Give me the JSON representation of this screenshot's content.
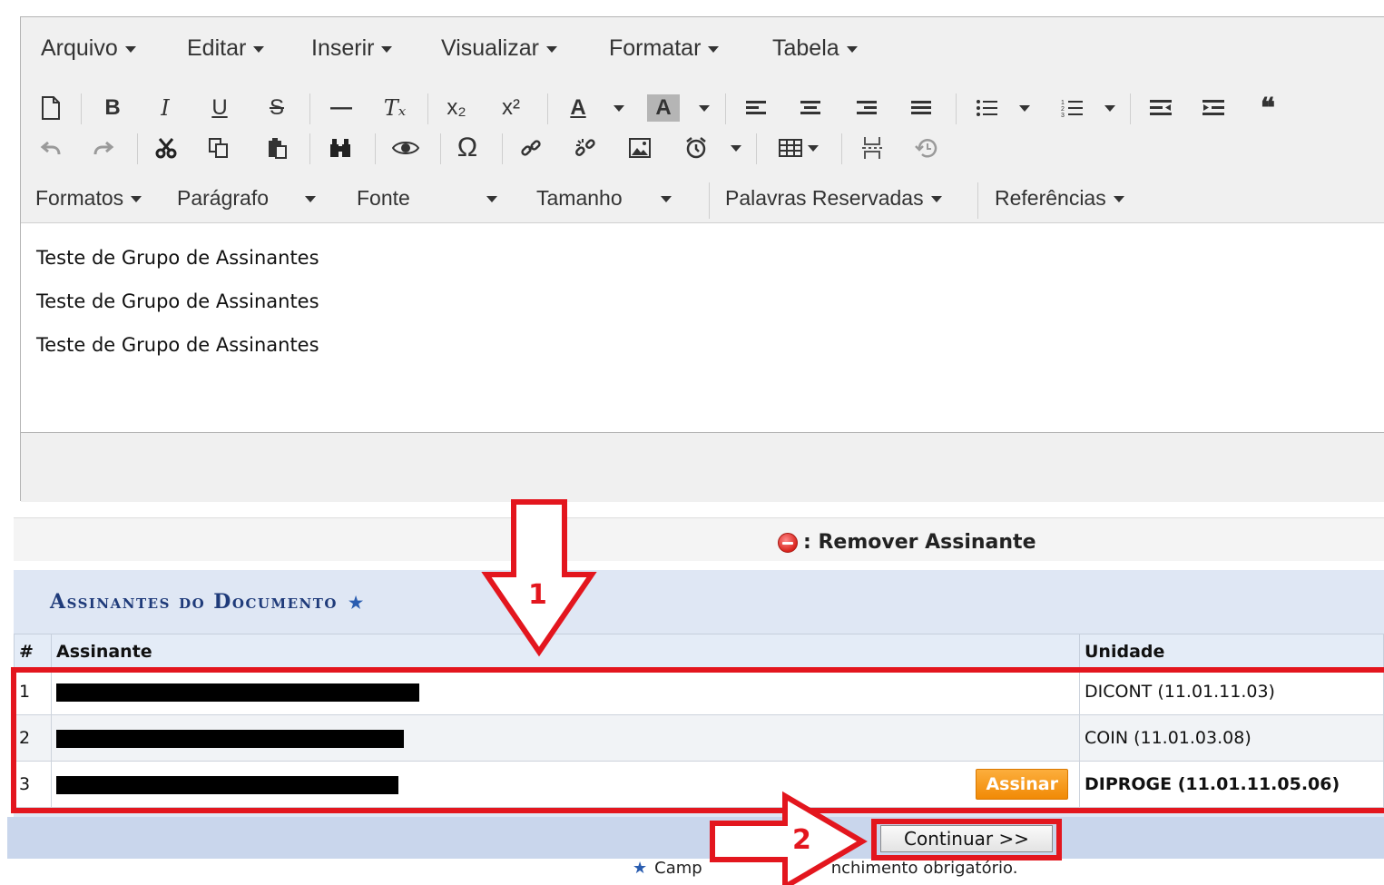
{
  "menubar": {
    "items": [
      "Arquivo",
      "Editar",
      "Inserir",
      "Visualizar",
      "Formatar",
      "Tabela"
    ]
  },
  "toolbar": {
    "row1": [
      "new-document",
      "bold",
      "italic",
      "underline",
      "strikethrough",
      "horizontal-rule",
      "clear-format",
      "subscript",
      "superscript",
      "text-color",
      "background-color",
      "align-left",
      "align-center",
      "align-right",
      "align-justify",
      "bullet-list",
      "numbered-list",
      "outdent",
      "indent",
      "blockquote"
    ],
    "row2": [
      "undo",
      "redo",
      "cut",
      "copy",
      "paste",
      "find-replace",
      "preview",
      "special-character",
      "link",
      "unlink",
      "image",
      "insert-time",
      "table",
      "page-break",
      "restore-draft"
    ],
    "glyphs": {
      "bold": "B",
      "italic": "I",
      "underline": "U",
      "strike": "S",
      "hr": "—",
      "clear": "Tₓ",
      "sub": "x₂",
      "sup": "x²",
      "textcolor": "A",
      "bgcolor": "A",
      "omega": "Ω",
      "quote": "❝"
    }
  },
  "dropdowns": {
    "formatos": "Formatos",
    "paragrafo": "Parágrafo",
    "fonte": "Fonte",
    "tamanho": "Tamanho",
    "palavras": "Palavras Reservadas",
    "referencias": "Referências"
  },
  "content": {
    "lines": [
      "Teste de Grupo de Assinantes",
      "Teste de Grupo de Assinantes",
      "Teste de Grupo de Assinantes"
    ]
  },
  "legend": {
    "label": ": Remover Assinante"
  },
  "signers": {
    "title": "Assinantes do Documento",
    "required_mark": "★",
    "headers": {
      "num": "#",
      "name": "Assinante",
      "unit": "Unidade"
    },
    "rows": [
      {
        "num": "1",
        "unit": "DICONT (11.01.11.03)"
      },
      {
        "num": "2",
        "unit": "COIN (11.01.03.08)"
      },
      {
        "num": "3",
        "unit": "DIPROGE (11.01.11.05.06)",
        "action": "Assinar"
      }
    ]
  },
  "footer": {
    "continue_label": "Continuar >>",
    "note_star": "★",
    "note_visible_start": "Camp",
    "note_visible_end": "nchimento obrigatório."
  },
  "annotations": {
    "arrow1_label": "1",
    "arrow2_label": "2",
    "color": "#e3161e"
  },
  "colors": {
    "assinar_button": "#f18a06",
    "panel_bg": "#dfe7f4",
    "panel_title": "#1f3b7a",
    "footer_bar": "#c9d6ec"
  }
}
